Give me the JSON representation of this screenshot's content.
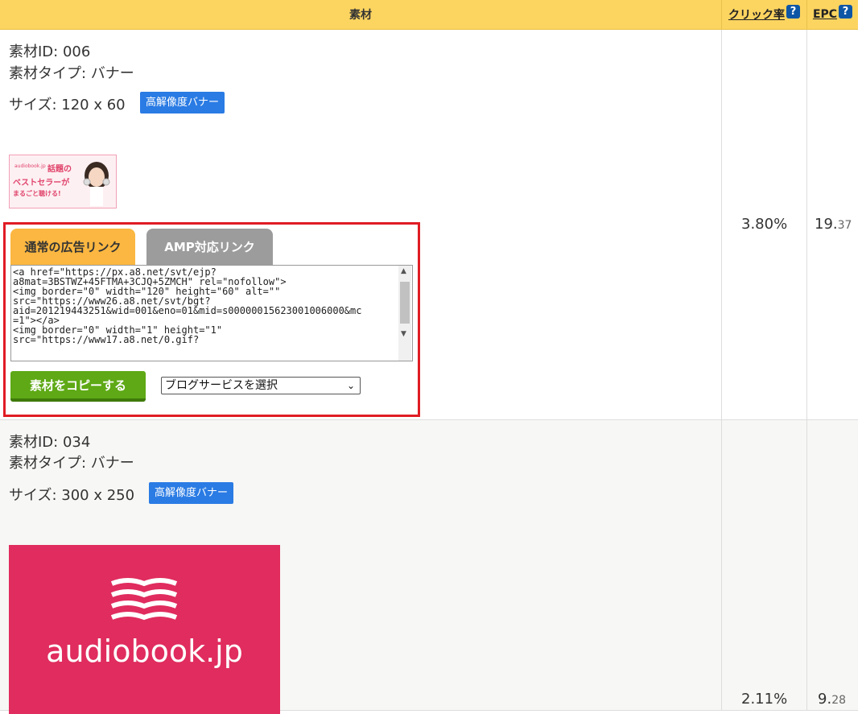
{
  "header": {
    "material": "素材",
    "click_rate": "クリック率",
    "epc": "EPC",
    "help_mark": "?"
  },
  "rows": [
    {
      "id_line": "素材ID: 006",
      "type_line": "素材タイプ: バナー",
      "size_line": "サイズ: 120 x 60",
      "badge": "高解像度バナー",
      "banner": {
        "brand": "audiobook.jp",
        "line1": "話題の",
        "line2": "ベストセラーが",
        "line3": "まるごと聴ける!"
      },
      "click_rate": "3.80%",
      "epc_main": "19.",
      "epc_small": "37"
    },
    {
      "id_line": "素材ID: 034",
      "type_line": "素材タイプ: バナー",
      "size_line": "サイズ: 300 x 250",
      "badge": "高解像度バナー",
      "banner": {
        "wordmark": "audiobook.jp"
      },
      "click_rate": "2.11%",
      "epc_main": "9.",
      "epc_small": "28"
    }
  ],
  "link_panel": {
    "tab_normal": "通常の広告リンク",
    "tab_amp": "AMP対応リンク",
    "code": "<a href=\"https://px.a8.net/svt/ejp?\na8mat=3BSTWZ+45FTMA+3CJQ+5ZMCH\" rel=\"nofollow\">\n<img border=\"0\" width=\"120\" height=\"60\" alt=\"\"\nsrc=\"https://www26.a8.net/svt/bgt?\naid=201219443251&wid=001&eno=01&mid=s00000015623001006000&mc\n=1\"></a>\n<img border=\"0\" width=\"1\" height=\"1\"\nsrc=\"https://www17.a8.net/0.gif?",
    "copy_button": "素材をコピーする",
    "blog_select": "ブログサービスを選択"
  },
  "colors": {
    "header_bg": "#fcd460",
    "badge": "#2a7be4",
    "highlight_border": "#e01c24",
    "tab_active": "#fbb741",
    "tab_inactive": "#9c9c9c",
    "copy_button": "#5ea915",
    "banner_pink": "#e02c5e"
  }
}
